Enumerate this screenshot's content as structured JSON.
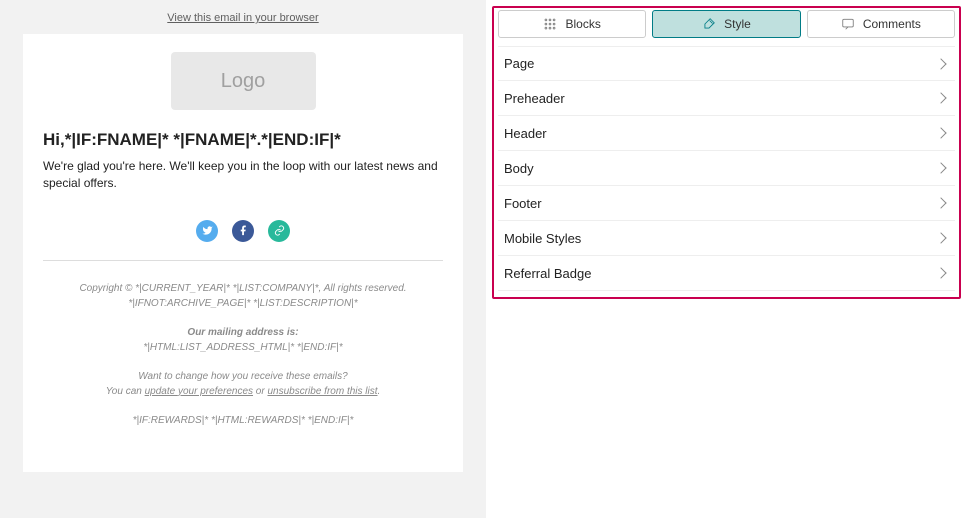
{
  "preview": {
    "browser_link": "View this email in your browser",
    "logo_text": "Logo",
    "greeting": "Hi,*|IF:FNAME|* *|FNAME|*.*|END:IF|*",
    "body": "We're glad you're here. We'll keep you in the loop with our latest news and special offers.",
    "footer": {
      "copyright_line1": "Copyright © *|CURRENT_YEAR|* *|LIST:COMPANY|*, All rights reserved.",
      "copyright_line2": "*|IFNOT:ARCHIVE_PAGE|* *|LIST:DESCRIPTION|*",
      "mailing_heading": "Our mailing address is:",
      "mailing_value": "*|HTML:LIST_ADDRESS_HTML|* *|END:IF|*",
      "pref_q": "Want to change how you receive these emails?",
      "pref_pre": "You can ",
      "pref_link1": "update your preferences",
      "pref_mid": " or ",
      "pref_link2": "unsubscribe from this list",
      "pref_post": ".",
      "rewards": "*|IF:REWARDS|* *|HTML:REWARDS|* *|END:IF|*"
    }
  },
  "tabs": {
    "blocks": "Blocks",
    "style": "Style",
    "comments": "Comments"
  },
  "style_sections": [
    "Page",
    "Preheader",
    "Header",
    "Body",
    "Footer",
    "Mobile Styles",
    "Referral Badge"
  ]
}
